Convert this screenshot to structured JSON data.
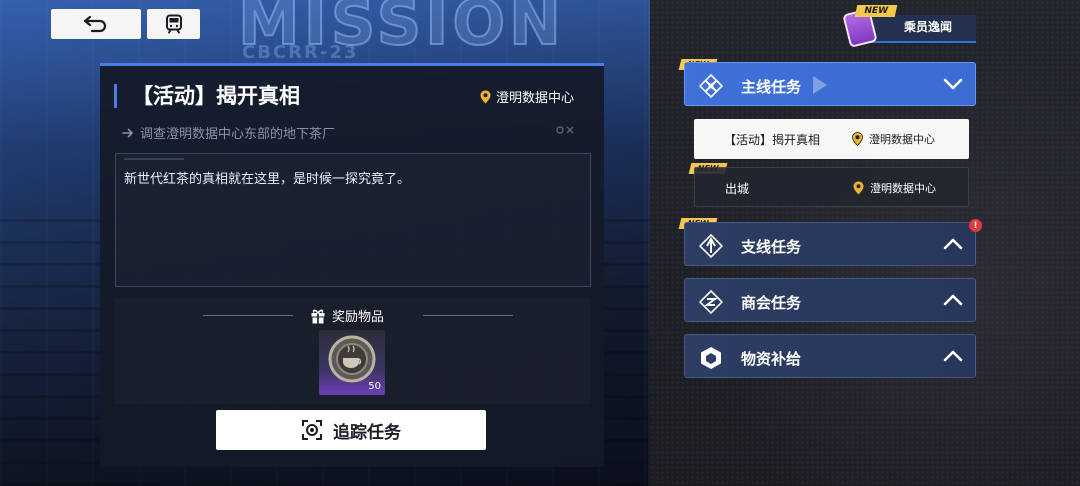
{
  "background": {
    "title_text": "MISSION",
    "code_text": "CBCRR-23"
  },
  "top_buttons": {
    "back_icon": "return-arrow-icon",
    "train_icon": "train-icon"
  },
  "detail": {
    "title": "【活动】揭开真相",
    "location": "澄明数据中心",
    "objective": "调查澄明数据中心东部的地下茶厂",
    "description": "新世代红茶的真相就在这里，是时候一探究竟了。",
    "reward_title": "奖励物品",
    "reward_item": {
      "icon": "tea-coin-icon",
      "count": "50"
    },
    "track_button": "追踪任务"
  },
  "crew": {
    "label": "乘员逸闻",
    "badge": "NEW"
  },
  "categories": [
    {
      "label": "主线任务",
      "badge": "NEW",
      "icon": "main-quest-icon",
      "expanded": true
    },
    {
      "label": "支线任务",
      "badge": "NEW",
      "icon": "side-quest-icon",
      "expanded": false,
      "alert": "!"
    },
    {
      "label": "商会任务",
      "icon": "guild-quest-icon",
      "expanded": false
    },
    {
      "label": "物资补给",
      "icon": "supply-icon",
      "expanded": false
    }
  ],
  "missions": [
    {
      "name": "【活动】揭开真相",
      "location": "澄明数据中心",
      "selected": true
    },
    {
      "name": "出城",
      "location": "澄明数据中心",
      "badge": "NEW",
      "selected": false
    }
  ],
  "colors": {
    "accent": "#4b7dea",
    "new_badge": "#f2c94c",
    "location_pin": "#f0b429",
    "alert": "#e23b3b"
  }
}
